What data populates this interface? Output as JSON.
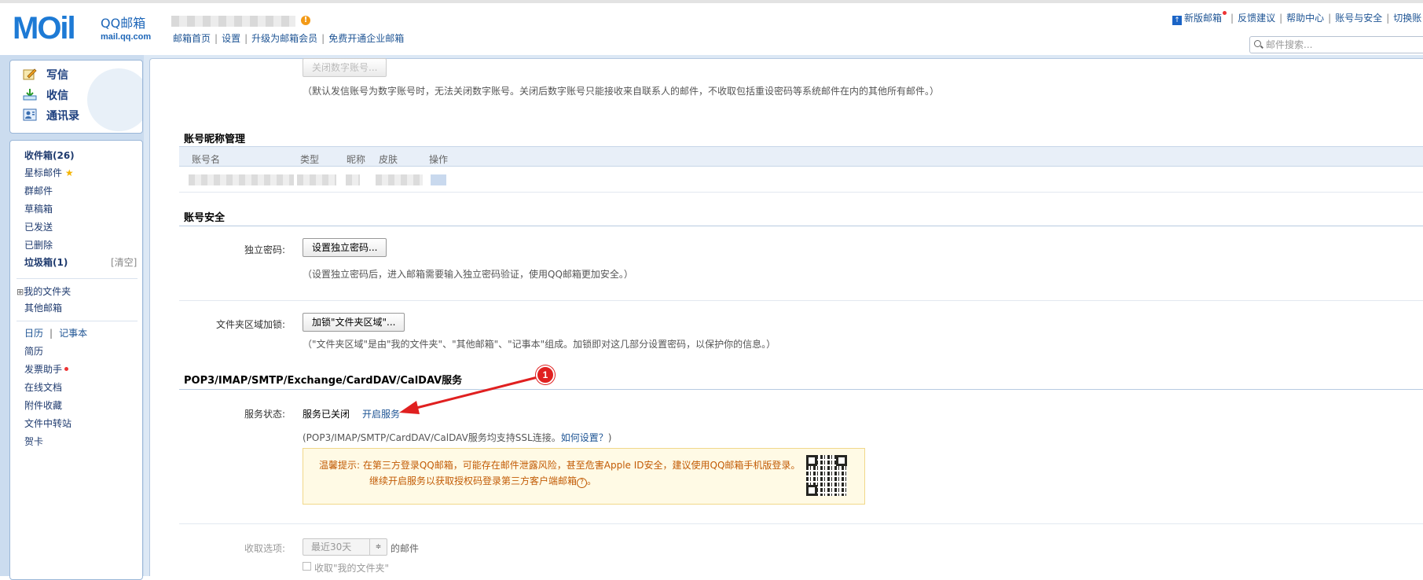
{
  "header": {
    "logo_text": "MOil",
    "brand_cn": "QQ邮箱",
    "brand_url": "mail.qq.com",
    "warn_glyph": "!",
    "nav": [
      "邮箱首页",
      "设置",
      "升级为邮箱会员",
      "免费开通企业邮箱"
    ],
    "new_icon_glyph": "↑",
    "top_links": [
      "新版邮箱",
      "反馈建议",
      "帮助中心",
      "账号与安全",
      "切换账"
    ],
    "search_placeholder": "邮件搜索..."
  },
  "quick": {
    "compose": "写信",
    "inbox": "收信",
    "contacts": "通讯录"
  },
  "folders": {
    "inbox": "收件箱(26)",
    "starred": "星标邮件",
    "star_glyph": "★",
    "group": "群邮件",
    "drafts": "草稿箱",
    "sent": "已发送",
    "deleted": "已删除",
    "spam": "垃圾箱(1)",
    "spam_clear": "[清空]",
    "expand_glyph": "⊞",
    "my_folders": "我的文件夹",
    "other_mail": "其他邮箱",
    "calendar": "日历",
    "cal_sep": "|",
    "notebook": "记事本",
    "resume": "简历",
    "invoice": "发票助手",
    "online_docs": "在线文档",
    "attach_fav": "附件收藏",
    "file_transfer": "文件中转站",
    "cards": "贺卡"
  },
  "content": {
    "close_digit_btn": "关闭数字账号...",
    "close_digit_note": "（默认发信账号为数字账号时，无法关闭数字账号。关闭后数字账号只能接收来自联系人的邮件，不收取包括重设密码等系统邮件在内的其他所有邮件。）",
    "nickname_section": "账号昵称管理",
    "table_headers": [
      "账号名",
      "类型",
      "昵称",
      "皮肤",
      "操作"
    ],
    "security_section": "账号安全",
    "indep_pwd_label": "独立密码:",
    "indep_pwd_btn": "设置独立密码...",
    "indep_pwd_note": "（设置独立密码后，进入邮箱需要输入独立密码验证，使用QQ邮箱更加安全。）",
    "folder_lock_label": "文件夹区域加锁:",
    "folder_lock_btn": "加锁\"文件夹区域\"...",
    "folder_lock_note": "（\"文件夹区域\"是由\"我的文件夹\"、\"其他邮箱\"、\"记事本\"组成。加锁即对这几部分设置密码，以保护你的信息。）",
    "pop_section": "POP3/IMAP/SMTP/Exchange/CardDAV/CalDAV服务",
    "service_label": "服务状态:",
    "service_status": "服务已关闭",
    "enable_service": "开启服务",
    "ssl_note": "(POP3/IMAP/SMTP/CardDAV/CalDAV服务均支持SSL连接。",
    "how_setup": "如何设置？",
    "ssl_note_end": ")",
    "tip_line1": "温馨提示:  在第三方登录QQ邮箱，可能存在邮件泄露风险，甚至危害Apple ID安全，建议使用QQ邮箱手机版登录。",
    "tip_line2": "继续开启服务以获取授权码登录第三方客户端邮箱",
    "tip_help_glyph": "?",
    "tip_end": "。",
    "receive_label": "收取选项:",
    "receive_select": "最近30天",
    "receive_select_arrow": "≑",
    "receive_suffix": "的邮件",
    "receive_myfolder": "收取\"我的文件夹\""
  },
  "annotation": {
    "badge_number": "1",
    "color": "#e02020"
  }
}
